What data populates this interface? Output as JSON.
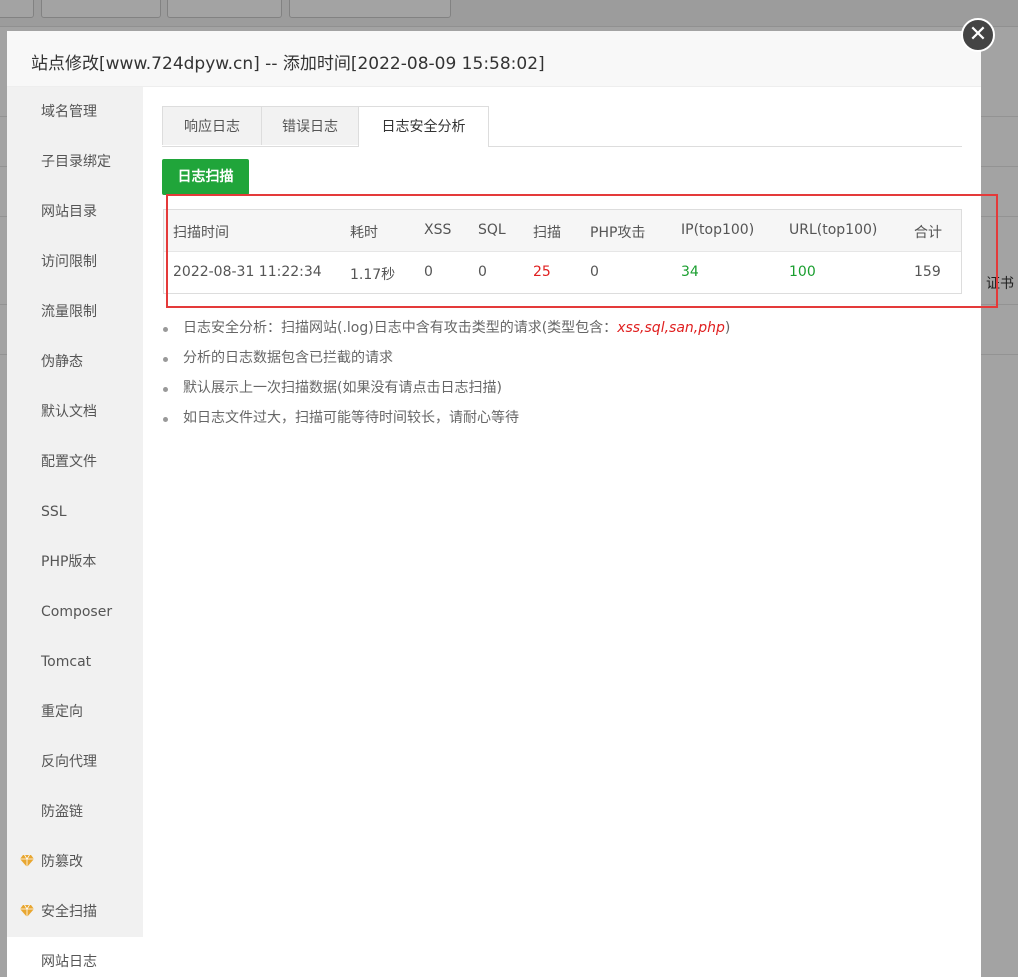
{
  "background": {
    "right_text": "证书"
  },
  "modal": {
    "title": "站点修改[www.724dpyw.cn] -- 添加时间[2022-08-09 15:58:02]",
    "close_glyph": "✕"
  },
  "sidebar": {
    "items": [
      {
        "label": "域名管理"
      },
      {
        "label": "子目录绑定"
      },
      {
        "label": "网站目录"
      },
      {
        "label": "访问限制"
      },
      {
        "label": "流量限制"
      },
      {
        "label": "伪静态"
      },
      {
        "label": "默认文档"
      },
      {
        "label": "配置文件"
      },
      {
        "label": "SSL"
      },
      {
        "label": "PHP版本"
      },
      {
        "label": "Composer"
      },
      {
        "label": "Tomcat"
      },
      {
        "label": "重定向"
      },
      {
        "label": "反向代理"
      },
      {
        "label": "防盗链"
      },
      {
        "label": "防篡改",
        "icon": "diamond-icon"
      },
      {
        "label": "安全扫描",
        "icon": "diamond-icon"
      },
      {
        "label": "网站日志",
        "active": true
      }
    ],
    "gem_color": "#e8a630"
  },
  "tabs": [
    {
      "label": "响应日志"
    },
    {
      "label": "错误日志"
    },
    {
      "label": "日志安全分析",
      "active": true
    }
  ],
  "scan_button": "日志扫描",
  "table": {
    "headers": [
      "扫描时间",
      "耗时",
      "XSS",
      "SQL",
      "扫描",
      "PHP攻击",
      "IP(top100)",
      "URL(top100)",
      "合计"
    ],
    "row": [
      "2022-08-31 11:22:34",
      "1.17秒",
      "0",
      "0",
      "25",
      "0",
      "34",
      "100",
      "159"
    ]
  },
  "notes": [
    {
      "text": "日志安全分析：扫描网站(.log)日志中含有攻击类型的请求(类型包含：",
      "emph": "xss,sql,san,php",
      "suffix": ")"
    },
    {
      "text": "分析的日志数据包含已拦截的请求"
    },
    {
      "text": "默认展示上一次扫描数据(如果没有请点击日志扫描)"
    },
    {
      "text": "如日志文件过大，扫描可能等待时间较长，请耐心等待"
    }
  ],
  "colors": {
    "accent_green": "#20a53a",
    "danger_red": "#e02020",
    "highlight_border": "#e43a3a"
  }
}
